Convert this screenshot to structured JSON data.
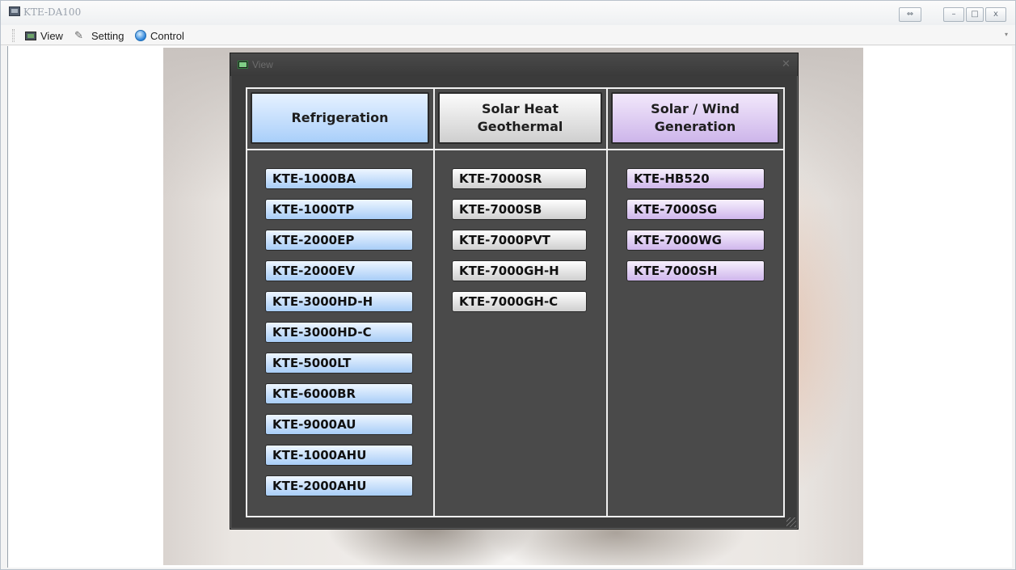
{
  "window": {
    "title": "KTE-DA100",
    "swap_icon": "⇔",
    "minimize_icon": "–",
    "maximize_icon": "□",
    "close_icon": "x"
  },
  "menu": {
    "items": [
      {
        "label": "View",
        "icon": "view-icon"
      },
      {
        "label": "Setting",
        "icon": "setting-icon"
      },
      {
        "label": "Control",
        "icon": "control-icon"
      }
    ],
    "overflow_icon": "▾"
  },
  "dialog": {
    "title": "View",
    "close_icon": "✕",
    "columns": [
      {
        "header": "Refrigeration",
        "color": "#a9cffa",
        "buttons": [
          "KTE-1000BA",
          "KTE-1000TP",
          "KTE-2000EP",
          "KTE-2000EV",
          "KTE-3000HD-H",
          "KTE-3000HD-C",
          "KTE-5000LT",
          "KTE-6000BR",
          "KTE-9000AU",
          "KTE-1000AHU",
          "KTE-2000AHU"
        ]
      },
      {
        "header": "Solar Heat\nGeothermal",
        "color": "#cfcfcf",
        "buttons": [
          "KTE-7000SR",
          "KTE-7000SB",
          "KTE-7000PVT",
          "KTE-7000GH-H",
          "KTE-7000GH-C"
        ]
      },
      {
        "header": "Solar / Wind\nGeneration",
        "color": "#cdb5ea",
        "buttons": [
          "KTE-HB520",
          "KTE-7000SG",
          "KTE-7000WG",
          "KTE-7000SH"
        ]
      }
    ]
  }
}
